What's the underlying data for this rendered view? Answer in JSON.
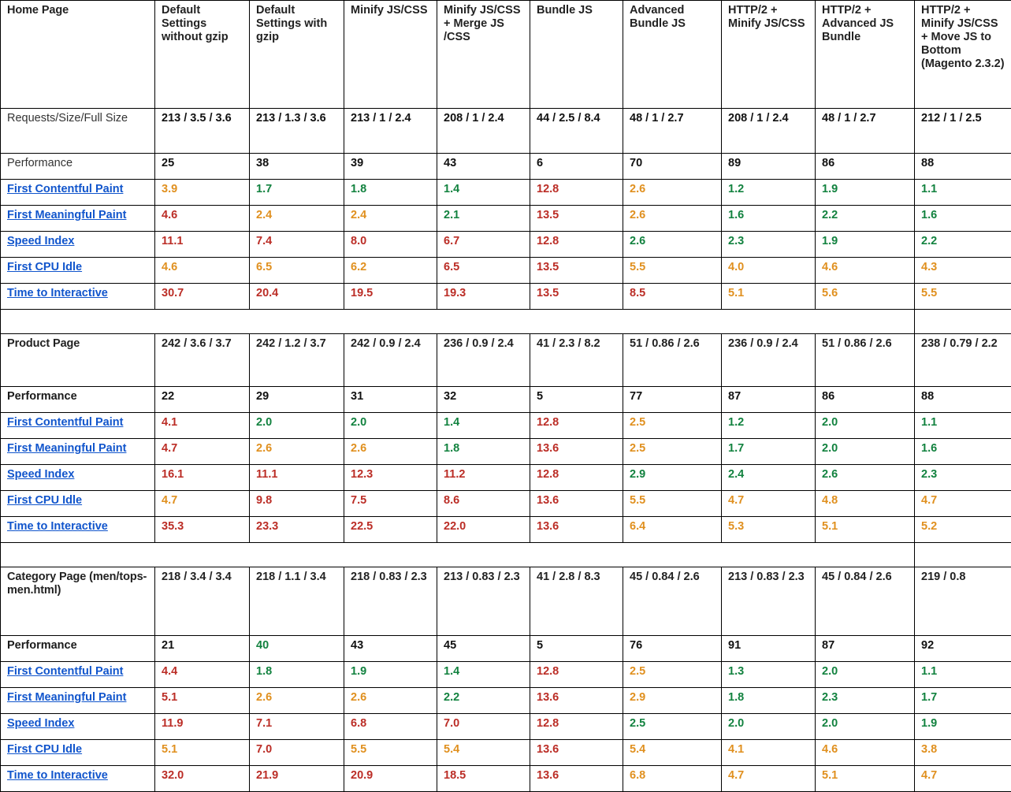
{
  "columns": [
    "Home Page",
    "Default Settings without  gzip",
    "Default Settings with gzip",
    "Minify JS/CSS",
    "Minify JS/CSS + Merge JS /CSS",
    "Bundle JS",
    "Advanced Bundle JS",
    "HTTP/2 + Minify JS/CSS",
    "HTTP/2 + Advanced JS Bundle",
    "HTTP/2 + Minify JS/CSS + Move JS to Bottom (Magento 2.3.2)"
  ],
  "metric_labels": {
    "requests": "Requests/Size/Full Size",
    "performance": "Performance",
    "fcp": "First Contentful Paint",
    "fmp": "First Meaningful Paint",
    "si": "Speed Index",
    "fci": "First CPU Idle",
    "tti": "Time to Interactive"
  },
  "colors": {
    "green": "#12823f",
    "orange": "#e0901f",
    "red": "#bb2d26",
    "link": "#1155cc",
    "text": "#111111",
    "border": "#000000"
  },
  "sections": [
    {
      "id": "home",
      "title": "Home Page",
      "title_in_header": true,
      "performance_label_bold": false,
      "rows": {
        "requests": [
          "213 / 3.5 / 3.6",
          "213 / 1.3 / 3.6",
          "213 / 1 / 2.4",
          "208 / 1 / 2.4",
          "44 / 2.5 / 8.4",
          "48 / 1 / 2.7",
          "208 / 1 / 2.4",
          "48 / 1 / 2.7",
          "212 / 1 / 2.5"
        ],
        "performance": [
          "25",
          "38",
          "39",
          "43",
          "6",
          "70",
          "89",
          "86",
          "88"
        ],
        "fcp": [
          "3.9",
          "1.7",
          "1.8",
          "1.4",
          "12.8",
          "2.6",
          "1.2",
          "1.9",
          "1.1"
        ],
        "fmp": [
          "4.6",
          "2.4",
          "2.4",
          "2.1",
          "13.5",
          "2.6",
          "1.6",
          "2.2",
          "1.6"
        ],
        "si": [
          "11.1",
          "7.4",
          "8.0",
          "6.7",
          "12.8",
          "2.6",
          "2.3",
          "1.9",
          "2.2"
        ],
        "fci": [
          "4.6",
          "6.5",
          "6.2",
          "6.5",
          "13.5",
          "5.5",
          "4.0",
          "4.6",
          "4.3"
        ],
        "tti": [
          "30.7",
          "20.4",
          "19.5",
          "19.3",
          "13.5",
          "8.5",
          "5.1",
          "5.6",
          "5.5"
        ]
      },
      "colors": {
        "performance": [
          "num",
          "num",
          "num",
          "num",
          "num",
          "num",
          "num",
          "num",
          "num"
        ],
        "fcp": [
          "orange",
          "green",
          "green",
          "green",
          "red",
          "orange",
          "green",
          "green",
          "green"
        ],
        "fmp": [
          "red",
          "orange",
          "orange",
          "green",
          "red",
          "orange",
          "green",
          "green",
          "green"
        ],
        "si": [
          "red",
          "red",
          "red",
          "red",
          "red",
          "green",
          "green",
          "green",
          "green"
        ],
        "fci": [
          "orange",
          "orange",
          "orange",
          "red",
          "red",
          "orange",
          "orange",
          "orange",
          "orange"
        ],
        "tti": [
          "red",
          "red",
          "red",
          "red",
          "red",
          "red",
          "orange",
          "orange",
          "orange"
        ]
      }
    },
    {
      "id": "product",
      "title": "Product Page",
      "title_in_header": false,
      "performance_label_bold": true,
      "rows": {
        "requests": [
          "242 / 3.6 / 3.7",
          "242 / 1.2 / 3.7",
          "242 / 0.9 / 2.4",
          "236 / 0.9 / 2.4",
          "41 / 2.3 / 8.2",
          "51 / 0.86 / 2.6",
          "236 / 0.9 / 2.4",
          "51 / 0.86 / 2.6",
          "238 / 0.79 / 2.2"
        ],
        "performance": [
          "22",
          "29",
          "31",
          "32",
          "5",
          "77",
          "87",
          "86",
          "88"
        ],
        "fcp": [
          "4.1",
          "2.0",
          "2.0",
          "1.4",
          "12.8",
          "2.5",
          "1.2",
          "2.0",
          "1.1"
        ],
        "fmp": [
          "4.7",
          "2.6",
          "2.6",
          "1.8",
          "13.6",
          "2.5",
          "1.7",
          "2.0",
          "1.6"
        ],
        "si": [
          "16.1",
          "11.1",
          "12.3",
          "11.2",
          "12.8",
          "2.9",
          "2.4",
          "2.6",
          "2.3"
        ],
        "fci": [
          "4.7",
          "9.8",
          "7.5",
          "8.6",
          "13.6",
          "5.5",
          "4.7",
          "4.8",
          "4.7"
        ],
        "tti": [
          "35.3",
          "23.3",
          "22.5",
          "22.0",
          "13.6",
          "6.4",
          "5.3",
          "5.1",
          "5.2"
        ]
      },
      "colors": {
        "performance": [
          "num",
          "num",
          "num",
          "num",
          "num",
          "num",
          "num",
          "num",
          "num"
        ],
        "fcp": [
          "red",
          "green",
          "green",
          "green",
          "red",
          "orange",
          "green",
          "green",
          "green"
        ],
        "fmp": [
          "red",
          "orange",
          "orange",
          "green",
          "red",
          "orange",
          "green",
          "green",
          "green"
        ],
        "si": [
          "red",
          "red",
          "red",
          "red",
          "red",
          "green",
          "green",
          "green",
          "green"
        ],
        "fci": [
          "orange",
          "red",
          "red",
          "red",
          "red",
          "orange",
          "orange",
          "orange",
          "orange"
        ],
        "tti": [
          "red",
          "red",
          "red",
          "red",
          "red",
          "orange",
          "orange",
          "orange",
          "orange"
        ]
      }
    },
    {
      "id": "category",
      "title": "Category Page (men/tops-men.html)",
      "title_in_header": false,
      "performance_label_bold": true,
      "rows": {
        "requests": [
          "218 / 3.4 / 3.4",
          "218 / 1.1 / 3.4",
          "218 / 0.83 / 2.3",
          "213 / 0.83 / 2.3",
          "41 / 2.8 / 8.3",
          "45 / 0.84 / 2.6",
          "213 / 0.83 / 2.3",
          "45 / 0.84 / 2.6",
          "219 / 0.8"
        ],
        "performance": [
          "21",
          "40",
          "43",
          "45",
          "5",
          "76",
          "91",
          "87",
          "92"
        ],
        "fcp": [
          "4.4",
          "1.8",
          "1.9",
          "1.4",
          "12.8",
          "2.5",
          "1.3",
          "2.0",
          "1.1"
        ],
        "fmp": [
          "5.1",
          "2.6",
          "2.6",
          "2.2",
          "13.6",
          "2.9",
          "1.8",
          "2.3",
          "1.7"
        ],
        "si": [
          "11.9",
          "7.1",
          "6.8",
          "7.0",
          "12.8",
          "2.5",
          "2.0",
          "2.0",
          "1.9"
        ],
        "fci": [
          "5.1",
          "7.0",
          "5.5",
          "5.4",
          "13.6",
          "5.4",
          "4.1",
          "4.6",
          "3.8"
        ],
        "tti": [
          "32.0",
          "21.9",
          "20.9",
          "18.5",
          "13.6",
          "6.8",
          "4.7",
          "5.1",
          "4.7"
        ]
      },
      "colors": {
        "performance": [
          "num",
          "green",
          "num",
          "num",
          "num",
          "num",
          "num",
          "num",
          "num"
        ],
        "fcp": [
          "red",
          "green",
          "green",
          "green",
          "red",
          "orange",
          "green",
          "green",
          "green"
        ],
        "fmp": [
          "red",
          "orange",
          "orange",
          "green",
          "red",
          "orange",
          "green",
          "green",
          "green"
        ],
        "si": [
          "red",
          "red",
          "red",
          "red",
          "red",
          "green",
          "green",
          "green",
          "green"
        ],
        "fci": [
          "orange",
          "red",
          "orange",
          "orange",
          "red",
          "orange",
          "orange",
          "orange",
          "orange"
        ],
        "tti": [
          "red",
          "red",
          "red",
          "red",
          "red",
          "orange",
          "orange",
          "orange",
          "orange"
        ]
      }
    }
  ]
}
